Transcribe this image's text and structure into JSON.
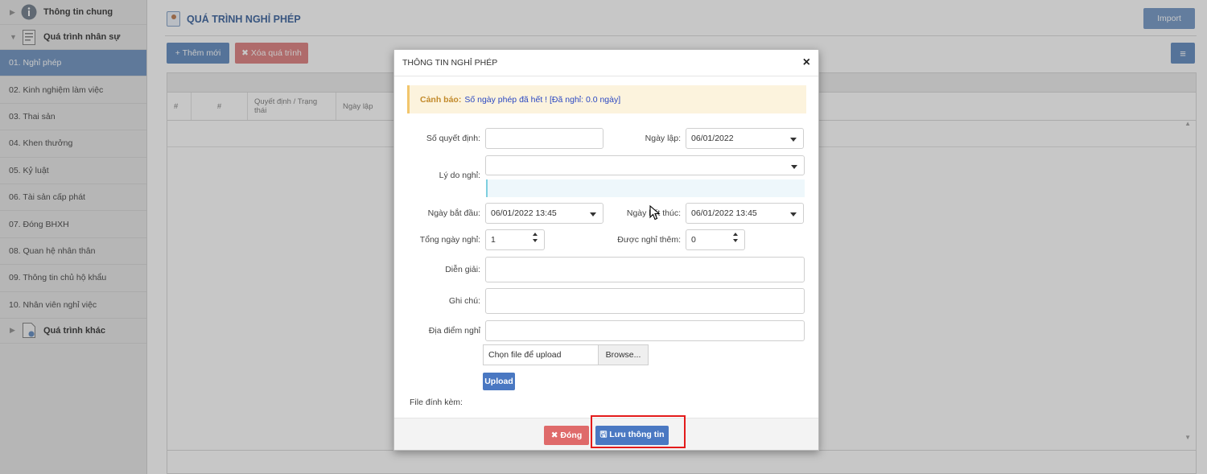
{
  "sidebar": {
    "group_general": "Thông tin chung",
    "group_hr": "Quá trình nhân sự",
    "items": [
      {
        "label": "01. Nghỉ phép"
      },
      {
        "label": "02. Kinh nghiệm làm việc"
      },
      {
        "label": "03. Thai sản"
      },
      {
        "label": "04. Khen thưởng"
      },
      {
        "label": "05. Kỷ luật"
      },
      {
        "label": "06. Tài sản cấp phát"
      },
      {
        "label": "07. Đóng BHXH"
      },
      {
        "label": "08. Quan hệ nhân thân"
      },
      {
        "label": "09. Thông tin chủ hộ khẩu"
      },
      {
        "label": "10. Nhân viên nghỉ việc"
      }
    ],
    "group_other": "Quá trình khác",
    "active_index": 0
  },
  "page": {
    "title": "QUÁ TRÌNH NGHỈ PHÉP",
    "import_label": "Import",
    "add_label": "+ Thêm mới",
    "delete_label": "✖ Xóa quá trình",
    "menu_icon": "list-icon"
  },
  "table": {
    "columns": [
      "#",
      "#",
      "Quyết định / Trạng thái",
      "Ngày lập"
    ]
  },
  "modal": {
    "title": "THÔNG TIN NGHỈ PHÉP",
    "warning_label": "Cảnh báo:",
    "warning_message": "Số ngày phép đã hết ! [Đã nghỉ: 0.0 ngày]",
    "fields": {
      "so_quyet_dinh": {
        "label": "Số quyết định:",
        "value": ""
      },
      "ngay_lap": {
        "label": "Ngày lập:",
        "value": "06/01/2022"
      },
      "ly_do_nghi": {
        "label": "Lý do nghỉ:",
        "value": ""
      },
      "ngay_bat_dau": {
        "label": "Ngày bắt đầu:",
        "value": "06/01/2022 13:45"
      },
      "ngay_ket_thuc": {
        "label": "Ngày kết thúc:",
        "value": "06/01/2022 13:45"
      },
      "tong_ngay_nghi": {
        "label": "Tổng ngày nghỉ:",
        "value": "1"
      },
      "duoc_nghi_them": {
        "label": "Được nghỉ thêm:",
        "value": "0"
      },
      "dien_giai": {
        "label": "Diễn giải:",
        "value": ""
      },
      "ghi_chu": {
        "label": "Ghi chú:",
        "value": ""
      },
      "dia_diem_nghi": {
        "label": "Địa điểm nghỉ",
        "value": ""
      }
    },
    "file_placeholder": "Chọn file để upload",
    "browse_label": "Browse...",
    "upload_label": "Upload",
    "attachment_label": "File đính kèm:",
    "close_label": "✖ Đóng",
    "save_label": "🖫 Lưu thông tin"
  },
  "colors": {
    "accent": "#4a78c2",
    "danger": "#df6a6a",
    "highlight": "#e31b1b",
    "sidebar_active": "#7a9cc6"
  }
}
